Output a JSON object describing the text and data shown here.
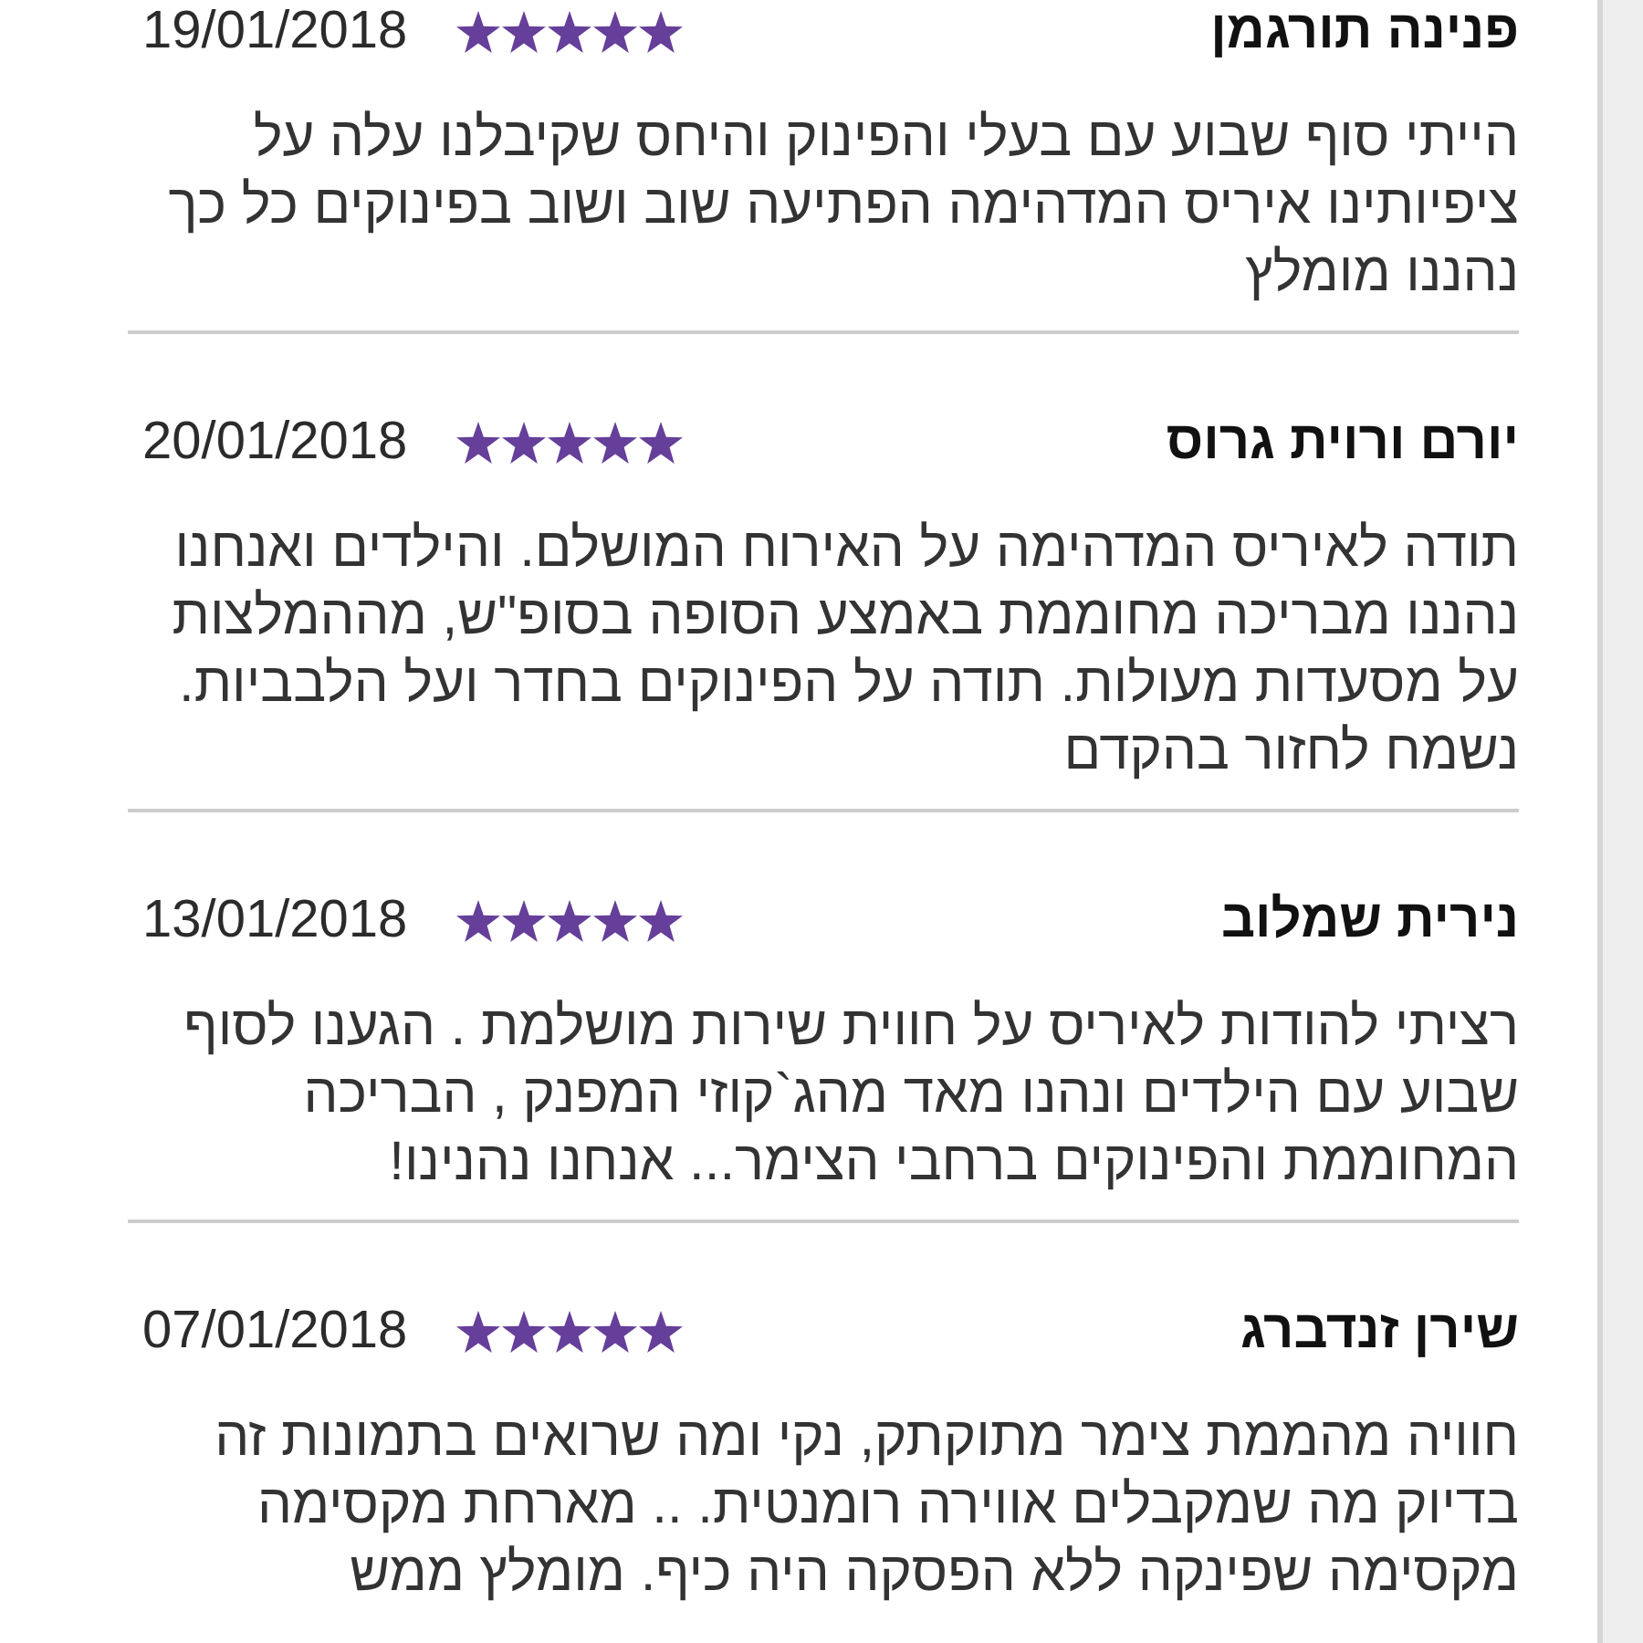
{
  "reviews": [
    {
      "name": "פנינה תורגמן",
      "stars": 5,
      "date": "19/01/2018",
      "body_lines": [
        "הייתי סוף שבוע עם בעלי והפינוק והיחס שקיבלנו עלה על",
        "ציפיותינו איריס המדהימה הפתיעה שוב ושוב בפינוקים כל כך",
        "נהננו מומלץ"
      ]
    },
    {
      "name": "יורם ורוית גרוס",
      "stars": 5,
      "date": "20/01/2018",
      "body_lines": [
        "תודה לאיריס המדהימה על האירוח המושלם. והילדים ואנחנו",
        "נהננו מבריכה מחוממת באמצע הסופה בסופ\"ש, מההמלצות",
        "על מסעדות מעולות. תודה על הפינוקים בחדר ועל הלבביות.",
        "נשמח לחזור בהקדם"
      ]
    },
    {
      "name": "נירית שמלוב",
      "stars": 5,
      "date": "13/01/2018",
      "body_lines": [
        "רציתי להודות לאיריס על חווית שירות מושלמת . הגענו לסוף",
        "שבוע עם הילדים ונהנו מאד מהג`קוזי המפנק , הבריכה",
        "המחוממת והפינוקים ברחבי הצימר... אנחנו נהנינו!"
      ]
    },
    {
      "name": "שירן זנדברג",
      "stars": 5,
      "date": "07/01/2018",
      "body_lines": [
        "חוויה מהממת צימר מתוקתק, נקי ומה שרואים בתמונות זה",
        "בדיוק מה שמקבלים אווירה רומנטית. .. מארחת מקסימה",
        "מקסימה שפינקה ללא הפסקה היה כיף. מומלץ ממש"
      ]
    }
  ]
}
